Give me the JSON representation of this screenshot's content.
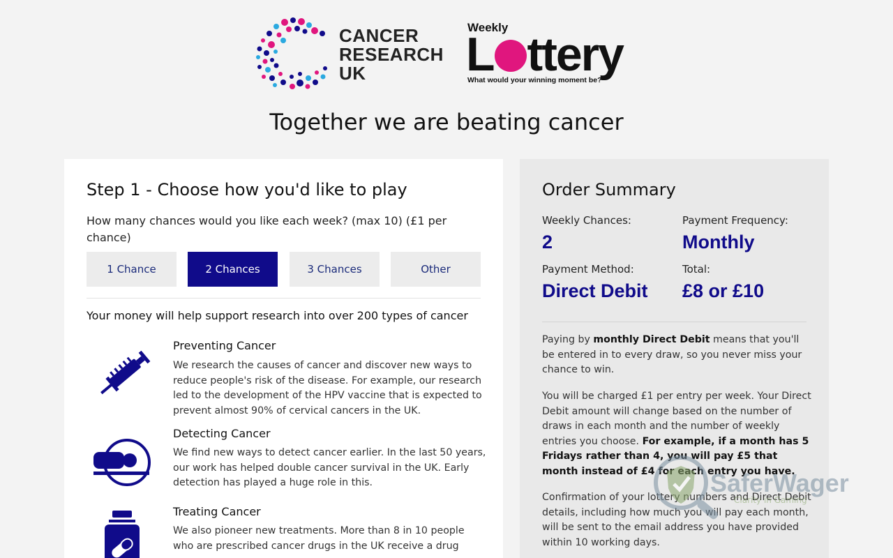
{
  "header": {
    "cruk_logo_line1": "CANCER",
    "cruk_logo_line2": "RESEARCH",
    "cruk_logo_line3": "UK",
    "lottery_small": "Weekly",
    "lottery_big_prefix": "L",
    "lottery_big_suffix": "ttery",
    "lottery_tagline": "What would your winning moment be?",
    "headline": "Together we are beating cancer"
  },
  "step": {
    "title": "Step 1 - Choose how you'd like to play",
    "question": "How many chances would you like each week? (max 10) (£1 per chance)",
    "options": [
      {
        "label": "1 Chance",
        "selected": false
      },
      {
        "label": "2 Chances",
        "selected": true
      },
      {
        "label": "3 Chances",
        "selected": false
      },
      {
        "label": "Other",
        "selected": false
      }
    ],
    "support_text": "Your money will help support research into over 200 types of cancer",
    "items": [
      {
        "icon": "syringe-icon",
        "title": "Preventing Cancer",
        "text": "We research the causes of cancer and discover new ways to reduce people's risk of the disease. For example, our research led to the development of the HPV vaccine that is expected to prevent almost 90% of cervical cancers in the UK."
      },
      {
        "icon": "scanner-icon",
        "title": "Detecting Cancer",
        "text": "We find new ways to detect cancer earlier. In the last 50 years, our work has helped double cancer survival in the UK. Early detection has played a huge role in this."
      },
      {
        "icon": "medicine-bottle-icon",
        "title": "Treating Cancer",
        "text": "We also pioneer new treatments. More than 8 in 10 people who are prescribed cancer drugs in the UK receive a drug"
      }
    ]
  },
  "summary": {
    "title": "Order Summary",
    "weekly_chances_label": "Weekly Chances:",
    "weekly_chances_value": "2",
    "payment_frequency_label": "Payment Frequency:",
    "payment_frequency_value": "Monthly",
    "payment_method_label": "Payment Method:",
    "payment_method_value": "Direct Debit",
    "total_label": "Total:",
    "total_value": "£8 or £10",
    "para1_a": "Paying by ",
    "para1_b": "monthly Direct Debit",
    "para1_c": " means that you'll be entered in to every draw, so you never miss your chance to win.",
    "para2_a": "You will be charged £1 per entry per week. Your Direct Debit amount will change based on the number of draws in each month and the number of weekly entries you choose. ",
    "para2_b": "For example, if a month has 5 Fridays rather than 4, you will pay £5 that month instead of £4 for each entry you have.",
    "para3": "Confirmation of your lottery numbers and Direct Debit details, including how much you will pay each month, will be sent to the email address you have provided within 10 working days."
  },
  "watermark": {
    "name": "SaferWager",
    "sub": "Clarity in Gaming"
  },
  "colors": {
    "primary_navy": "#100b8a",
    "magenta": "#e0167e",
    "cyan": "#2aa9e0"
  }
}
